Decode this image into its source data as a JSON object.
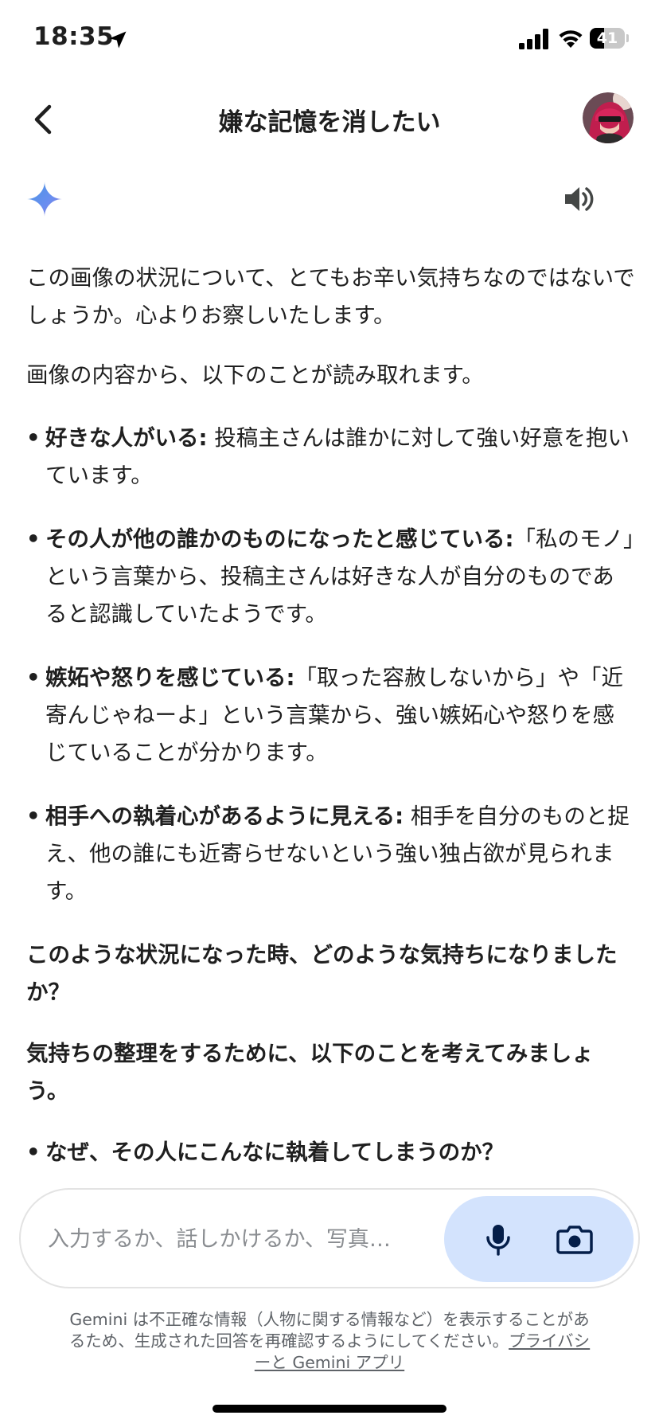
{
  "status_bar": {
    "time": "18:35",
    "battery_level": "41",
    "battery_fraction": 0.41,
    "icons": [
      "location-arrow-icon",
      "cellular-signal-icon",
      "wifi-icon",
      "battery-icon"
    ]
  },
  "header": {
    "title": "嫌な記憶を消したい",
    "back_icon": "chevron-left-icon",
    "avatar_icon": "user-avatar"
  },
  "response": {
    "logo_icon": "gemini-sparkle-icon",
    "speaker_icon": "speaker-icon",
    "para1": "この画像の状況について、とてもお辛い気持ちなのではないでしょうか。心よりお察しいたします。",
    "para2": "画像の内容から、以下のことが読み取れます。",
    "bullets": [
      {
        "bold": "好きな人がいる:",
        "text": " 投稿主さんは誰かに対して強い好意を抱いています。"
      },
      {
        "bold": "その人が他の誰かのものになったと感じている:",
        "text": "「私のモノ」という言葉から、投稿主さんは好きな人が自分のものであると認識していたようです。"
      },
      {
        "bold": "嫉妬や怒りを感じている:",
        "text": "「取った容赦しないから」や「近寄んじゃねーよ」という言葉から、強い嫉妬心や怒りを感じていることが分かります。"
      },
      {
        "bold": "相手への執着心があるように見える:",
        "text": " 相手を自分のものと捉え、他の誰にも近寄らせないという強い独占欲が見られます。"
      }
    ],
    "question": "このような状況になった時、どのような気持ちになりましたか？",
    "para3": "気持ちの整理をするために、以下のことを考えてみましょう。",
    "partial_item": "なぜ、その人にこんなに執着してしまうのか？"
  },
  "input": {
    "placeholder": "入力するか、話しかけるか、写真…",
    "mic_icon": "microphone-icon",
    "camera_icon": "camera-icon"
  },
  "disclaimer": {
    "text": "Gemini は不正確な情報（人物に関する情報など）を表示することがあるため、生成された回答を再確認するようにしてください。",
    "link": "プライバシーと Gemini アプリ"
  },
  "colors": {
    "action_pill_bg": "#d3e3fd",
    "icon_dark_blue": "#041e49",
    "text_primary": "#1f1f1f",
    "text_secondary": "#5f6368"
  }
}
